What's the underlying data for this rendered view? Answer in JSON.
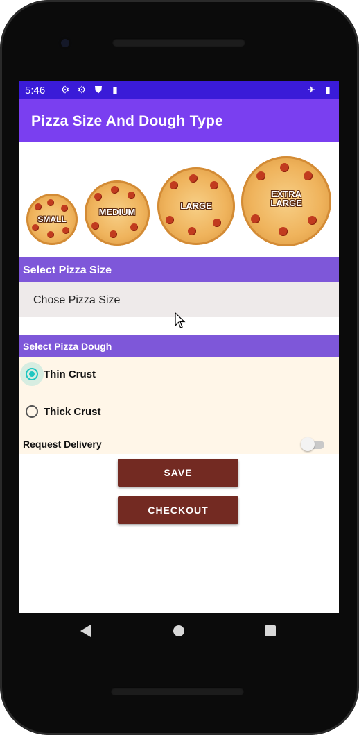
{
  "status_bar": {
    "time": "5:46",
    "left_icons": [
      "settings-icon",
      "settings-icon",
      "shield-icon",
      "sd-card-icon"
    ],
    "right_icons": [
      "airplane-mode-icon",
      "battery-icon"
    ]
  },
  "app_bar": {
    "title": "Pizza Size And Dough Type",
    "color": "#7a3ff0"
  },
  "pizza_banner": {
    "labels": [
      "SMALL",
      "MEDIUM",
      "LARGE",
      "EXTRA\nLARGE"
    ]
  },
  "size_section": {
    "header": "Select Pizza Size",
    "spinner_placeholder": "Chose Pizza Size"
  },
  "dough_section": {
    "header": "Select Pizza Dough",
    "options": [
      {
        "label": "Thin Crust",
        "checked": true
      },
      {
        "label": "Thick Crust",
        "checked": false
      }
    ],
    "delivery_label": "Request Delivery",
    "delivery_on": false
  },
  "buttons": {
    "save": "SAVE",
    "checkout": "CHECKOUT",
    "color": "#732a22"
  },
  "nav": [
    "back-icon",
    "home-icon",
    "recents-icon"
  ]
}
